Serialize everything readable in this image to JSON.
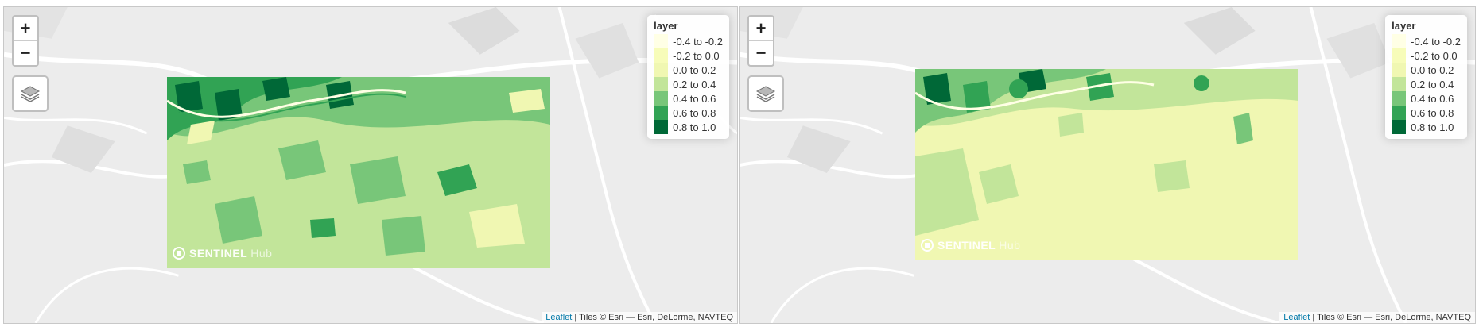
{
  "maps": [
    {
      "zoom": {
        "in_label": "+",
        "out_label": "−"
      },
      "legend": {
        "title": "layer",
        "items": [
          {
            "label": "-0.4 to -0.2",
            "color": "#ffffe5"
          },
          {
            "label": "-0.2 to 0.0",
            "color": "#f7fcb9"
          },
          {
            "label": "0.0 to 0.2",
            "color": "#f0f7b2"
          },
          {
            "label": "0.2 to 0.4",
            "color": "#c2e59a"
          },
          {
            "label": "0.4 to 0.6",
            "color": "#78c679"
          },
          {
            "label": "0.6 to 0.8",
            "color": "#31a354"
          },
          {
            "label": "0.8 to 1.0",
            "color": "#006837"
          }
        ]
      },
      "watermark": {
        "brand": "SENTINEL",
        "suffix": "Hub"
      },
      "attribution": {
        "link": "Leaflet",
        "text": " | Tiles © Esri — Esri, DeLorme, NAVTEQ"
      },
      "layers_icon": "layers-icon"
    },
    {
      "zoom": {
        "in_label": "+",
        "out_label": "−"
      },
      "legend": {
        "title": "layer",
        "items": [
          {
            "label": "-0.4 to -0.2",
            "color": "#ffffe5"
          },
          {
            "label": "-0.2 to 0.0",
            "color": "#f7fcb9"
          },
          {
            "label": "0.0 to 0.2",
            "color": "#f0f7b2"
          },
          {
            "label": "0.2 to 0.4",
            "color": "#c2e59a"
          },
          {
            "label": "0.4 to 0.6",
            "color": "#78c679"
          },
          {
            "label": "0.6 to 0.8",
            "color": "#31a354"
          },
          {
            "label": "0.8 to 1.0",
            "color": "#006837"
          }
        ]
      },
      "watermark": {
        "brand": "SENTINEL",
        "suffix": "Hub"
      },
      "attribution": {
        "link": "Leaflet",
        "text": " | Tiles © Esri — Esri, DeLorme, NAVTEQ"
      },
      "layers_icon": "layers-icon"
    }
  ]
}
